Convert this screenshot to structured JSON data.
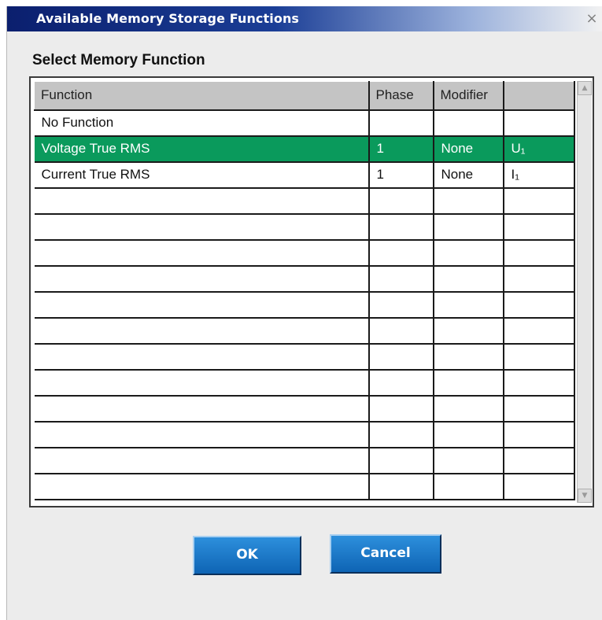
{
  "dialog": {
    "title": "Available Memory Storage Functions",
    "close_label": "×"
  },
  "section": {
    "label": "Select Memory Function"
  },
  "table": {
    "columns": [
      "Function",
      "Phase",
      "Modifier",
      ""
    ],
    "rows": [
      {
        "function": "No Function",
        "phase": "",
        "modifier": "",
        "symbol": "",
        "selected": false
      },
      {
        "function": "Voltage True RMS",
        "phase": "1",
        "modifier": "None",
        "symbol": "U₁",
        "selected": true
      },
      {
        "function": "Current True RMS",
        "phase": "1",
        "modifier": "None",
        "symbol": "I₁",
        "selected": false
      }
    ],
    "empty_rows": 12,
    "selected_color": "#0a9a5c"
  },
  "buttons": {
    "ok_label": "OK",
    "cancel_label": "Cancel"
  },
  "icons": {
    "close": "close-icon",
    "scroll_up": "scroll-up-arrow-icon",
    "scroll_down": "scroll-down-arrow-icon"
  }
}
